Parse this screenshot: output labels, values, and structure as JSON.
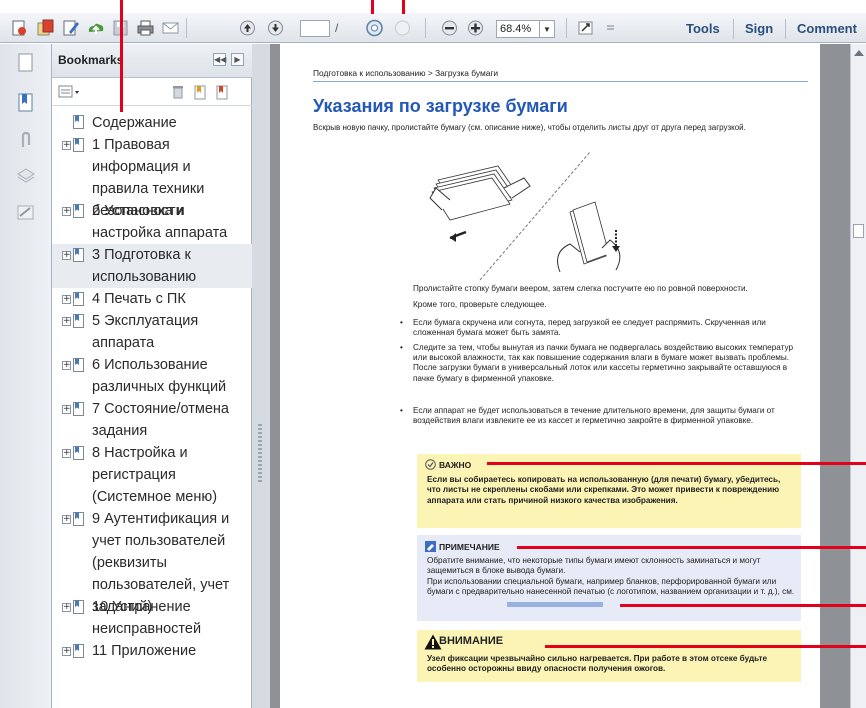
{
  "toolbar": {
    "page_current": "",
    "page_separator": "/",
    "page_total": "",
    "zoom": "68.4%",
    "links": [
      "Tools",
      "Sign",
      "Comment"
    ]
  },
  "bookmarks": {
    "title": "Bookmarks",
    "items": [
      {
        "label": "Содержание",
        "expandable": false,
        "selected": false
      },
      {
        "label": "1 Правовая информация и правила техники безопасности",
        "expandable": true,
        "selected": false
      },
      {
        "label": "2 Установка и настройка аппарата",
        "expandable": true,
        "selected": false
      },
      {
        "label": "3 Подготовка к использованию",
        "expandable": true,
        "selected": true
      },
      {
        "label": "4 Печать с ПК",
        "expandable": true,
        "selected": false
      },
      {
        "label": "5 Эксплуатация аппарата",
        "expandable": true,
        "selected": false
      },
      {
        "label": "6 Использование различных функций",
        "expandable": true,
        "selected": false
      },
      {
        "label": "7 Состояние/отмена задания",
        "expandable": true,
        "selected": false
      },
      {
        "label": "8 Настройка и регистрация (Системное меню)",
        "expandable": true,
        "selected": false
      },
      {
        "label": "9 Аутентификация и учет пользователей (реквизиты пользователей, учет заданий)",
        "expandable": true,
        "selected": false
      },
      {
        "label": "10 Устранение неисправностей",
        "expandable": true,
        "selected": false
      },
      {
        "label": "11 Приложение",
        "expandable": true,
        "selected": false
      }
    ]
  },
  "document": {
    "breadcrumb": "Подготовка к использованию > Загрузка бумаги",
    "title": "Указания по загрузке бумаги",
    "intro": "Вскрыв новую пачку, пролистайте бумагу (см. описание ниже), чтобы отделить листы друг от друга перед загрузкой.",
    "after_illustration": "Пролистайте стопку бумаги веером, затем слегка постучите ею по ровной поверхности.",
    "also_check": "Кроме того, проверьте следующее.",
    "bullets": [
      "Если бумага скручена или согнута, перед загрузкой ее следует распрямить. Скрученная или сложенная бумага может быть замята.",
      "Следите за тем, чтобы вынутая из пачки бумага не подвергалась воздействию высоких температур или высокой влажности, так как повышение содержания влаги в бумаге может вызвать проблемы. После загрузки бумаги в универсальный лоток или кассеты герметично закрывайте оставшуюся в пачке бумагу в фирменной упаковке.",
      "Если аппарат не будет использоваться в течение длительного времени, для защиты бумаги от воздействия влаги извлеките ее из кассет и герметично закройте в фирменной упаковке."
    ],
    "important": {
      "heading": "ВАЖНО",
      "text": "Если вы собираетесь копировать на использованную (для печати) бумагу, убедитесь, что листы не скреплены скобами или скрепками. Это может привести к повреждению аппарата или стать причиной низкого качества изображения."
    },
    "note": {
      "heading": "ПРИМЕЧАНИЕ",
      "text1": "Обратите внимание, что некоторые типы бумаги имеют склонность заминаться и могут защемиться в блоке вывода бумаги.",
      "text2": "При использовании специальной бумаги, например бланков, перфорированной бумаги или бумаги с предварительно нанесенной печатью (с логотипом, названием организации и т. д.), см."
    },
    "caution": {
      "heading": "ВНИМАНИЕ",
      "text": "Узел фиксации чрезвычайно сильно нагревается. При работе в этом отсеке будьте особенно осторожны ввиду опасности получения ожогов."
    }
  },
  "colors": {
    "accent_title": "#2458b8",
    "important_bg": "#fbf4b5",
    "note_bg": "#e7eaf7",
    "callout_red": "#e3001b"
  }
}
